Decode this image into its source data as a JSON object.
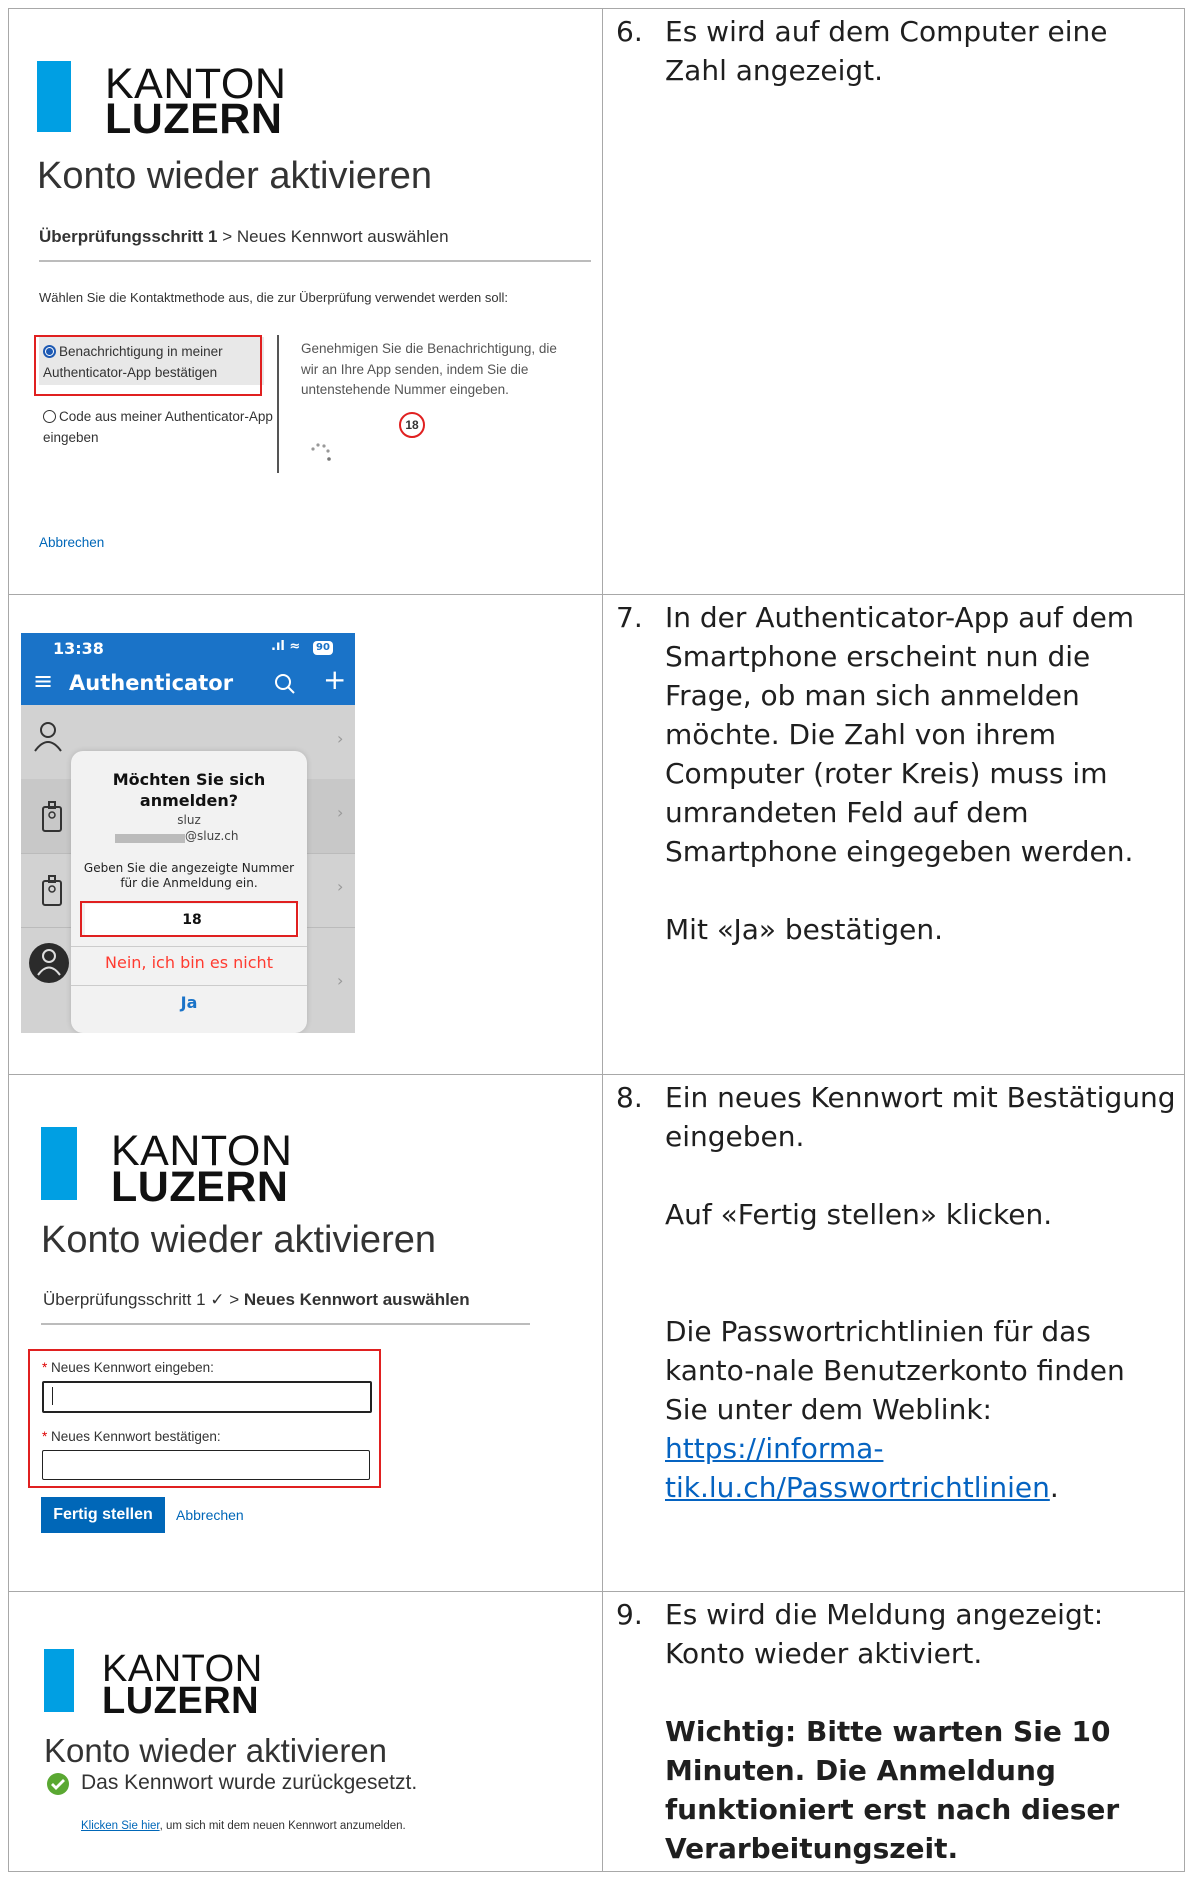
{
  "rows": [
    {
      "step_number": "6.",
      "paragraphs": [
        "Es wird auf dem Computer eine Zahl angezeigt."
      ],
      "screenshot": {
        "logo_line1": "KANTON",
        "logo_line2": "LUZERN",
        "title": "Konto wieder aktivieren",
        "crumb_step": "Überprüfungsschritt 1",
        "crumb_sep": " > ",
        "crumb_next": "Neues Kennwort auswählen",
        "instruction": "Wählen Sie die Kontaktmethode aus, die zur Überprüfung verwendet werden soll:",
        "option1": "Benachrichtigung in meiner Authenticator-App bestätigen",
        "option2": "Code aus meiner Authenticator-App eingeben",
        "approve_text": "Genehmigen Sie die Benachrichtigung, die wir an Ihre App senden, indem Sie die untenstehende Nummer eingeben.",
        "number": "18",
        "cancel": "Abbrechen"
      }
    },
    {
      "step_number": "7.",
      "paragraphs": [
        "In der Authenticator-App auf dem Smartphone erscheint nun die Frage, ob man sich anmelden möchte. Die Zahl von ihrem Computer (roter Kreis) muss im umrandeten Feld auf dem Smartphone eingegeben werden.",
        "Mit «Ja» bestätigen."
      ],
      "phone": {
        "time": "13:38",
        "battery": "90",
        "app_title": "Authenticator",
        "dialog_title": "Möchten Sie sich anmelden?",
        "dialog_org": "sluz",
        "dialog_account": "@sluz.ch",
        "dialog_prompt": "Geben Sie die angezeigte Nummer für die Anmeldung ein.",
        "entered_number": "18",
        "deny": "Nein, ich bin es nicht",
        "confirm": "Ja",
        "accent_color": "#1a73c8",
        "deny_color": "#ff3b30"
      }
    },
    {
      "step_number": "8.",
      "paragraphs": [
        "Ein neues Kennwort mit Bestätigung eingeben.",
        "Auf «Fertig stellen» klicken.",
        "Die Passwortrichtlinien für das kanto-nale Benutzerkonto finden Sie unter dem Weblink:"
      ],
      "link_text": "https://informa-tik.lu.ch/Passwortrichtlinien",
      "link_trailing": ".",
      "screenshot": {
        "logo_line1": "KANTON",
        "logo_line2": "LUZERN",
        "title": "Konto wieder aktivieren",
        "crumb_step": "Überprüfungsschritt 1 ✓",
        "crumb_sep": " > ",
        "crumb_next": "Neues Kennwort auswählen",
        "field1_label": "Neues Kennwort eingeben:",
        "field2_label": "Neues Kennwort bestätigen:",
        "required_mark": "*",
        "submit": "Fertig stellen",
        "cancel": "Abbrechen"
      }
    },
    {
      "step_number": "9.",
      "paragraphs": [
        "Es wird die Meldung angezeigt: Konto wieder aktiviert."
      ],
      "important": "Wichtig: Bitte warten Sie 10 Minuten. Die Anmeldung funktioniert erst nach dieser Verarbeitungszeit.",
      "screenshot": {
        "logo_line1": "KANTON",
        "logo_line2": "LUZERN",
        "title": "Konto wieder aktivieren",
        "success": "Das Kennwort wurde zurückgesetzt.",
        "link": "Klicken Sie hier",
        "link_rest": ", um sich mit dem neuen Kennwort anzumelden."
      }
    }
  ],
  "colors": {
    "brand_blue": "#009fe3",
    "button_blue": "#0067b8",
    "highlight_red": "#e02020",
    "success_green": "#5aa832"
  }
}
